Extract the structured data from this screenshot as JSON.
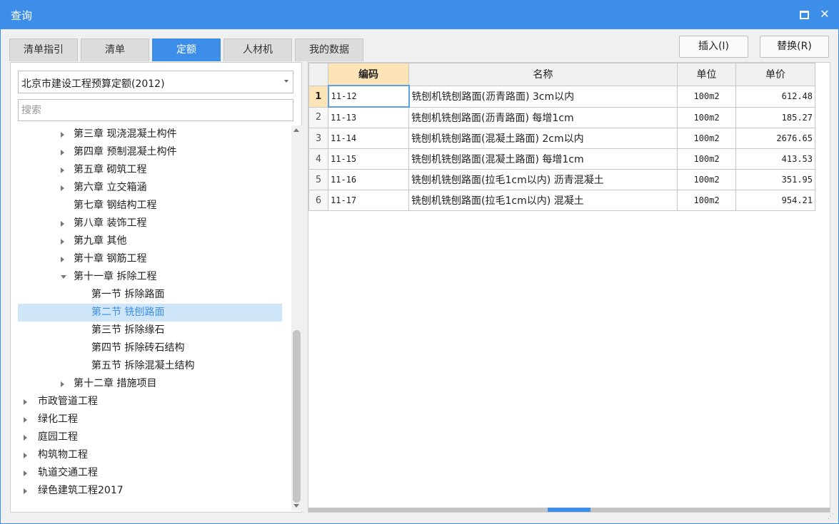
{
  "window": {
    "title": "查询"
  },
  "tabs": [
    {
      "label": "清单指引"
    },
    {
      "label": "清单"
    },
    {
      "label": "定额"
    },
    {
      "label": "人材机"
    },
    {
      "label": "我的数据"
    }
  ],
  "actions": {
    "insert": "插入(I)",
    "replace": "替换(R)"
  },
  "library": {
    "selected": "北京市建设工程预算定额(2012)"
  },
  "search": {
    "placeholder": "搜索"
  },
  "tree": [
    {
      "label": "第三章 现浇混凝土构件",
      "level": 1,
      "arrow": "right"
    },
    {
      "label": "第四章 预制混凝土构件",
      "level": 1,
      "arrow": "right"
    },
    {
      "label": "第五章 砌筑工程",
      "level": 1,
      "arrow": "right"
    },
    {
      "label": "第六章 立交箱涵",
      "level": 1,
      "arrow": "right"
    },
    {
      "label": "第七章 钢结构工程",
      "level": 1,
      "arrow": "none"
    },
    {
      "label": "第八章 装饰工程",
      "level": 1,
      "arrow": "right"
    },
    {
      "label": "第九章 其他",
      "level": 1,
      "arrow": "right"
    },
    {
      "label": "第十章 钢筋工程",
      "level": 1,
      "arrow": "right"
    },
    {
      "label": "第十一章 拆除工程",
      "level": 1,
      "arrow": "down"
    },
    {
      "label": "第一节 拆除路面",
      "level": 2,
      "arrow": "none"
    },
    {
      "label": "第二节 铣刨路面",
      "level": 2,
      "arrow": "none",
      "selected": true
    },
    {
      "label": "第三节 拆除缘石",
      "level": 2,
      "arrow": "none"
    },
    {
      "label": "第四节 拆除砖石结构",
      "level": 2,
      "arrow": "none"
    },
    {
      "label": "第五节 拆除混凝土结构",
      "level": 2,
      "arrow": "none"
    },
    {
      "label": "第十二章 措施项目",
      "level": 1,
      "arrow": "right"
    },
    {
      "label": "市政管道工程",
      "level": 0,
      "arrow": "right"
    },
    {
      "label": "绿化工程",
      "level": 0,
      "arrow": "right"
    },
    {
      "label": "庭园工程",
      "level": 0,
      "arrow": "right"
    },
    {
      "label": "构筑物工程",
      "level": 0,
      "arrow": "right"
    },
    {
      "label": "轨道交通工程",
      "level": 0,
      "arrow": "right"
    },
    {
      "label": "绿色建筑工程2017",
      "level": 0,
      "arrow": "right"
    }
  ],
  "grid": {
    "headers": {
      "code": "编码",
      "name": "名称",
      "unit": "单位",
      "price": "单价"
    },
    "rows": [
      {
        "idx": "1",
        "code": "11-12",
        "name": "铣刨机铣刨路面(沥青路面) 3cm以内",
        "unit": "100m2",
        "price": "612.48"
      },
      {
        "idx": "2",
        "code": "11-13",
        "name": "铣刨机铣刨路面(沥青路面) 每增1cm",
        "unit": "100m2",
        "price": "185.27"
      },
      {
        "idx": "3",
        "code": "11-14",
        "name": "铣刨机铣刨路面(混凝土路面) 2cm以内",
        "unit": "100m2",
        "price": "2676.65"
      },
      {
        "idx": "4",
        "code": "11-15",
        "name": "铣刨机铣刨路面(混凝土路面) 每增1cm",
        "unit": "100m2",
        "price": "413.53"
      },
      {
        "idx": "5",
        "code": "11-16",
        "name": "铣刨机铣刨路面(拉毛1cm以内) 沥青混凝土",
        "unit": "100m2",
        "price": "351.95"
      },
      {
        "idx": "6",
        "code": "11-17",
        "name": "铣刨机铣刨路面(拉毛1cm以内) 混凝土",
        "unit": "100m2",
        "price": "954.21"
      }
    ]
  },
  "colors": {
    "accent": "#3d8ee8",
    "header_active": "#fde4b6",
    "selected_row": "#cfe5f8"
  },
  "icons": {
    "maximize": "maximize-icon",
    "close": "close-icon"
  }
}
